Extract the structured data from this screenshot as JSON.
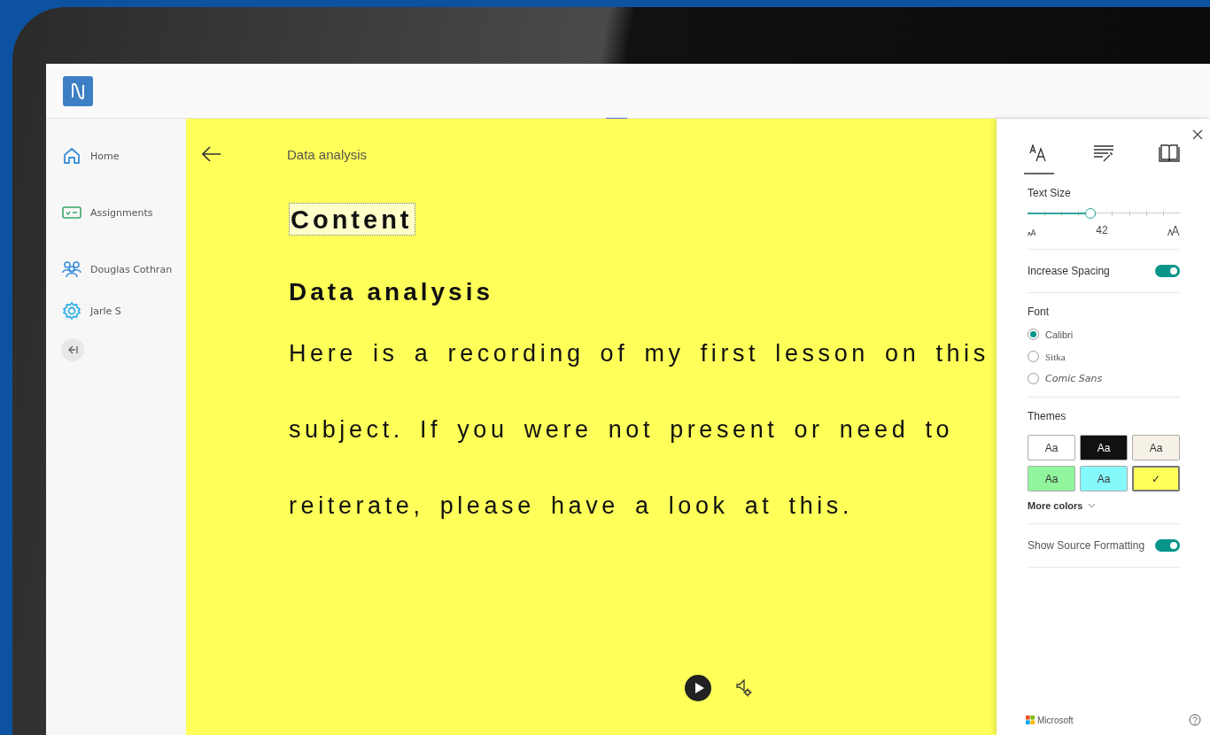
{
  "sidebar": {
    "items": [
      {
        "label": "Home"
      },
      {
        "label": "Assignments"
      },
      {
        "label": "Douglas Cothran"
      },
      {
        "label": "Jarle S"
      }
    ]
  },
  "reader": {
    "back_title": "Data analysis",
    "heading": "Content",
    "subheading": "Data analysis",
    "body": "Here is a recording of my first lesson on this subject. If you were not present or need to reiterate, please have a look at this."
  },
  "panel": {
    "tabs": [
      {
        "kind": "text",
        "selected": true
      },
      {
        "kind": "grammar",
        "selected": false
      },
      {
        "kind": "reading",
        "selected": false
      }
    ],
    "text_size": {
      "label": "Text Size",
      "level": 0.41,
      "reading": "42"
    },
    "increase_spacing": {
      "label": "Increase Spacing",
      "on": true
    },
    "font": {
      "label": "Font",
      "options": [
        {
          "label": "Calibri",
          "selected": true
        },
        {
          "label": "Sitka",
          "selected": false
        },
        {
          "label": "Comic Sans",
          "selected": false
        }
      ]
    },
    "themes": {
      "label": "Themes",
      "swatches": [
        {
          "label": "Aa",
          "color": "#ffffff",
          "selected": false
        },
        {
          "label": "Aa",
          "color": "#111111",
          "selected": false
        },
        {
          "label": "Aa",
          "color": "#f6f1e6",
          "selected": false
        },
        {
          "label": "Aa",
          "color": "#90f59c",
          "selected": false
        },
        {
          "label": "Aa",
          "color": "#85f8fb",
          "selected": false
        },
        {
          "label": "✓",
          "color": "#ffff59",
          "selected": true
        }
      ],
      "more": "More colors"
    },
    "source_formatting": {
      "label": "Show Source Formatting",
      "on": true
    },
    "footer": "Microsoft"
  }
}
